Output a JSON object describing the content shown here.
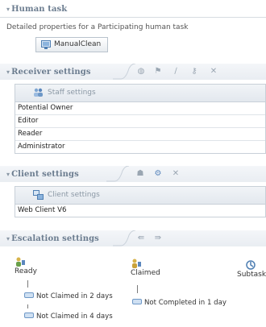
{
  "human_task": {
    "title": "Human task",
    "description": "Detailed properties for a Participating human task",
    "task_button": "ManualClean"
  },
  "receiver_settings": {
    "title": "Receiver settings",
    "table_header": "Staff settings",
    "rows": [
      "Potential Owner",
      "Editor",
      "Reader",
      "Administrator"
    ],
    "toolbar_icons": [
      "add-icon",
      "flag-icon",
      "edit-icon",
      "key-icon",
      "delete-icon"
    ]
  },
  "client_settings": {
    "title": "Client settings",
    "table_header": "Client settings",
    "rows": [
      "Web Client V6"
    ],
    "toolbar_icons": [
      "people-icon",
      "settings-icon",
      "delete-icon"
    ]
  },
  "escalation_settings": {
    "title": "Escalation settings",
    "toolbar_icons": [
      "arrow-icon",
      "arrow-icon"
    ],
    "states": [
      {
        "label": "Ready",
        "escalations": [
          "Not Claimed in 2 days",
          "Not Claimed in 4 days"
        ]
      },
      {
        "label": "Claimed",
        "escalations": [
          "Not Completed in 1 day"
        ]
      },
      {
        "label": "Subtask",
        "escalations": []
      }
    ]
  },
  "colors": {
    "section_title": "#6b7c8f",
    "header_band": "#e9edf2",
    "border": "#c8d0d8",
    "icon_blue": "#6e98c7"
  }
}
